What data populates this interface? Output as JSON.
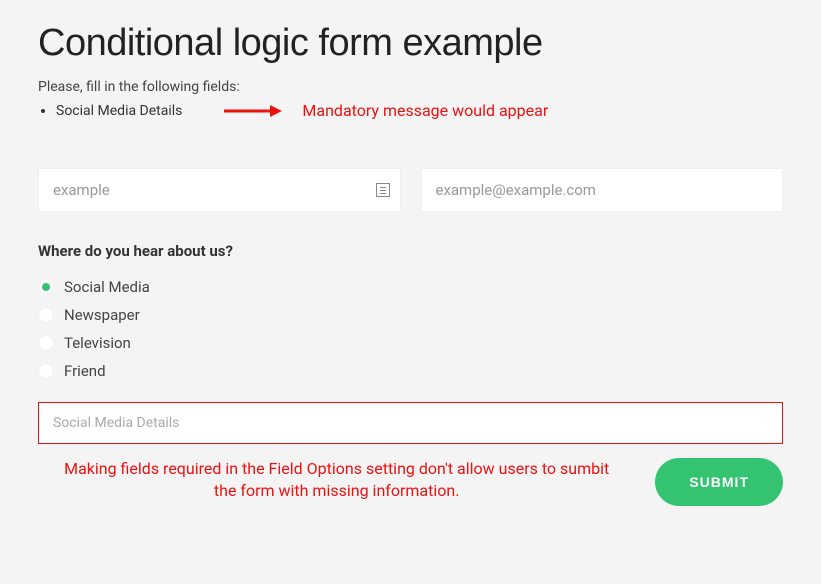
{
  "title": "Conditional logic form example",
  "instruction": "Please, fill in the following fields:",
  "validation_item": "Social Media Details",
  "annotation_top": "Mandatory message would appear",
  "inputs": {
    "name_value": "example",
    "email_value": "example@example.com"
  },
  "question": "Where do you hear about us?",
  "options": {
    "o1": "Social Media",
    "o2": "Newspaper",
    "o3": "Television",
    "o4": "Friend"
  },
  "details_placeholder": "Social Media Details",
  "annotation_bottom": "Making fields required in the Field Options setting don't allow users to sumbit the form with missing information.",
  "submit_label": "SUBMIT",
  "colors": {
    "accent": "#34c471",
    "error": "#e11"
  }
}
